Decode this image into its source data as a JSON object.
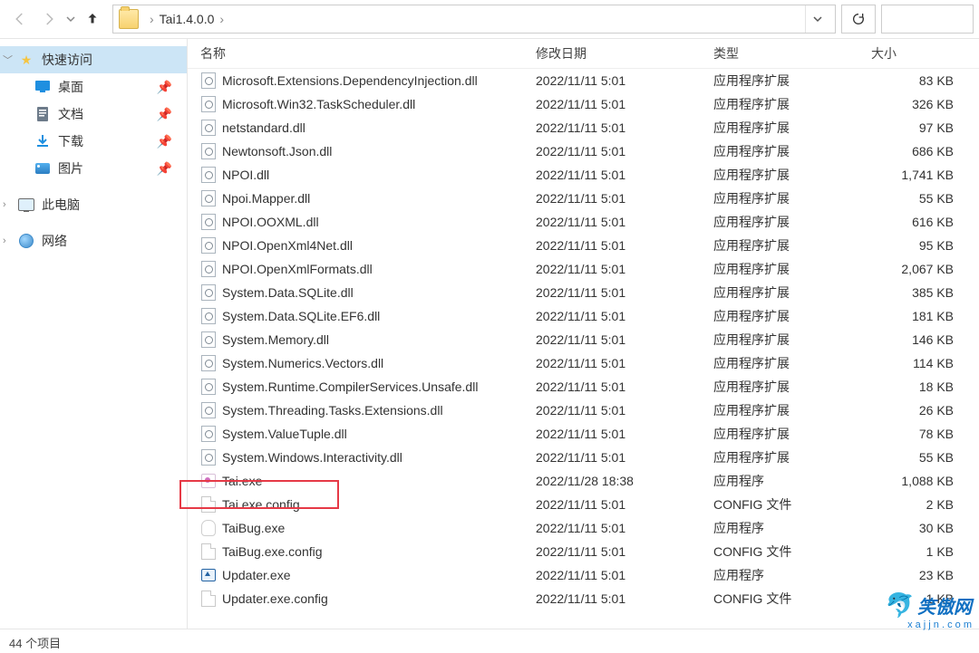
{
  "address": {
    "crumbs": [
      "Tai1.4.0.0"
    ]
  },
  "sidebar": {
    "items": [
      {
        "label": "快速访问"
      },
      {
        "label": "桌面"
      },
      {
        "label": "文档"
      },
      {
        "label": "下载"
      },
      {
        "label": "图片"
      },
      {
        "label": "此电脑"
      },
      {
        "label": "网络"
      }
    ]
  },
  "columns": {
    "name": "名称",
    "date": "修改日期",
    "type": "类型",
    "size": "大小"
  },
  "files": [
    {
      "icon": "dll-gear",
      "name": "Microsoft.Extensions.DependencyInjection.dll",
      "date": "2022/11/11 5:01",
      "type": "应用程序扩展",
      "size": "83 KB"
    },
    {
      "icon": "dll-gear",
      "name": "Microsoft.Win32.TaskScheduler.dll",
      "date": "2022/11/11 5:01",
      "type": "应用程序扩展",
      "size": "326 KB"
    },
    {
      "icon": "dll-gear",
      "name": "netstandard.dll",
      "date": "2022/11/11 5:01",
      "type": "应用程序扩展",
      "size": "97 KB"
    },
    {
      "icon": "dll-gear",
      "name": "Newtonsoft.Json.dll",
      "date": "2022/11/11 5:01",
      "type": "应用程序扩展",
      "size": "686 KB"
    },
    {
      "icon": "dll-gear",
      "name": "NPOI.dll",
      "date": "2022/11/11 5:01",
      "type": "应用程序扩展",
      "size": "1,741 KB"
    },
    {
      "icon": "dll-gear",
      "name": "Npoi.Mapper.dll",
      "date": "2022/11/11 5:01",
      "type": "应用程序扩展",
      "size": "55 KB"
    },
    {
      "icon": "dll-gear",
      "name": "NPOI.OOXML.dll",
      "date": "2022/11/11 5:01",
      "type": "应用程序扩展",
      "size": "616 KB"
    },
    {
      "icon": "dll-gear",
      "name": "NPOI.OpenXml4Net.dll",
      "date": "2022/11/11 5:01",
      "type": "应用程序扩展",
      "size": "95 KB"
    },
    {
      "icon": "dll-gear",
      "name": "NPOI.OpenXmlFormats.dll",
      "date": "2022/11/11 5:01",
      "type": "应用程序扩展",
      "size": "2,067 KB"
    },
    {
      "icon": "dll-gear",
      "name": "System.Data.SQLite.dll",
      "date": "2022/11/11 5:01",
      "type": "应用程序扩展",
      "size": "385 KB"
    },
    {
      "icon": "dll-gear",
      "name": "System.Data.SQLite.EF6.dll",
      "date": "2022/11/11 5:01",
      "type": "应用程序扩展",
      "size": "181 KB"
    },
    {
      "icon": "dll-gear",
      "name": "System.Memory.dll",
      "date": "2022/11/11 5:01",
      "type": "应用程序扩展",
      "size": "146 KB"
    },
    {
      "icon": "dll-gear",
      "name": "System.Numerics.Vectors.dll",
      "date": "2022/11/11 5:01",
      "type": "应用程序扩展",
      "size": "114 KB"
    },
    {
      "icon": "dll-gear",
      "name": "System.Runtime.CompilerServices.Unsafe.dll",
      "date": "2022/11/11 5:01",
      "type": "应用程序扩展",
      "size": "18 KB"
    },
    {
      "icon": "dll-gear",
      "name": "System.Threading.Tasks.Extensions.dll",
      "date": "2022/11/11 5:01",
      "type": "应用程序扩展",
      "size": "26 KB"
    },
    {
      "icon": "dll-gear",
      "name": "System.ValueTuple.dll",
      "date": "2022/11/11 5:01",
      "type": "应用程序扩展",
      "size": "78 KB"
    },
    {
      "icon": "dll-gear",
      "name": "System.Windows.Interactivity.dll",
      "date": "2022/11/11 5:01",
      "type": "应用程序扩展",
      "size": "55 KB"
    },
    {
      "icon": "exe",
      "name": "Tai.exe",
      "date": "2022/11/28 18:38",
      "type": "应用程序",
      "size": "1,088 KB",
      "highlight": true
    },
    {
      "icon": "txt",
      "name": "Tai.exe.config",
      "date": "2022/11/11 5:01",
      "type": "CONFIG 文件",
      "size": "2 KB"
    },
    {
      "icon": "bug",
      "name": "TaiBug.exe",
      "date": "2022/11/11 5:01",
      "type": "应用程序",
      "size": "30 KB"
    },
    {
      "icon": "txt",
      "name": "TaiBug.exe.config",
      "date": "2022/11/11 5:01",
      "type": "CONFIG 文件",
      "size": "1 KB"
    },
    {
      "icon": "upd",
      "name": "Updater.exe",
      "date": "2022/11/11 5:01",
      "type": "应用程序",
      "size": "23 KB"
    },
    {
      "icon": "txt",
      "name": "Updater.exe.config",
      "date": "2022/11/11 5:01",
      "type": "CONFIG 文件",
      "size": "1 KB"
    }
  ],
  "statusbar": {
    "text": "44 个项目"
  },
  "watermark": {
    "title": "笑傲网",
    "url": "x a j j n . c o m"
  }
}
